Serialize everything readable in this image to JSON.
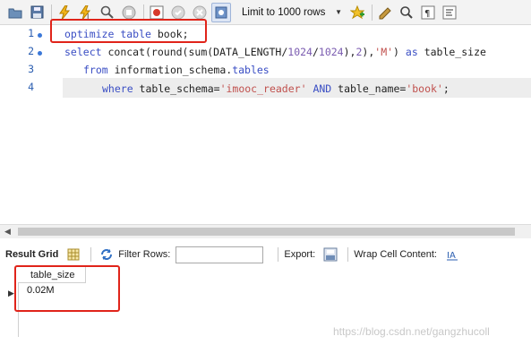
{
  "toolbar": {
    "limit_select": "Limit to 1000 rows",
    "icons": [
      "open-folder-icon",
      "save-icon",
      "execute-icon",
      "execute-current-icon",
      "explain-icon",
      "stop-icon",
      "toggle-error-icon",
      "commit-icon",
      "rollback-icon",
      "autocommit-icon",
      "add-snippet-icon",
      "beautify-icon",
      "find-icon",
      "invisible-chars-icon",
      "word-wrap-icon"
    ]
  },
  "editor": {
    "line_numbers": [
      "1",
      "2",
      "3",
      "4"
    ],
    "lines": {
      "l1": {
        "kw1": "optimize",
        "kw2": "table",
        "rest": " book;"
      },
      "l2": {
        "kw1": "select",
        "p1": " concat(round(sum(DATA_LENGTH/",
        "n1": "1024",
        "p2": "/",
        "n2": "1024",
        "p3": "),",
        "n3": "2",
        "p4": "),",
        "s1": "'M'",
        "p5": ") ",
        "kw2": "as",
        "p6": " table_size"
      },
      "l3": {
        "kw1": "from",
        "p1": " information_schema.",
        "kw2": "tables"
      },
      "l4": {
        "kw1": "where",
        "p1": " table_schema=",
        "s1": "'imooc_reader'",
        "p2": " ",
        "kw2": "AND",
        "p3": " table_name=",
        "s2": "'book'",
        "p4": ";"
      }
    }
  },
  "results_toolbar": {
    "result_grid": "Result Grid",
    "filter_rows": "Filter Rows:",
    "export": "Export:",
    "wrap_cell": "Wrap Cell Content:"
  },
  "grid": {
    "columns": [
      "table_size"
    ],
    "rows": [
      [
        "0.02M"
      ]
    ]
  },
  "watermark": "https://blog.csdn.net/gangzhucoll"
}
